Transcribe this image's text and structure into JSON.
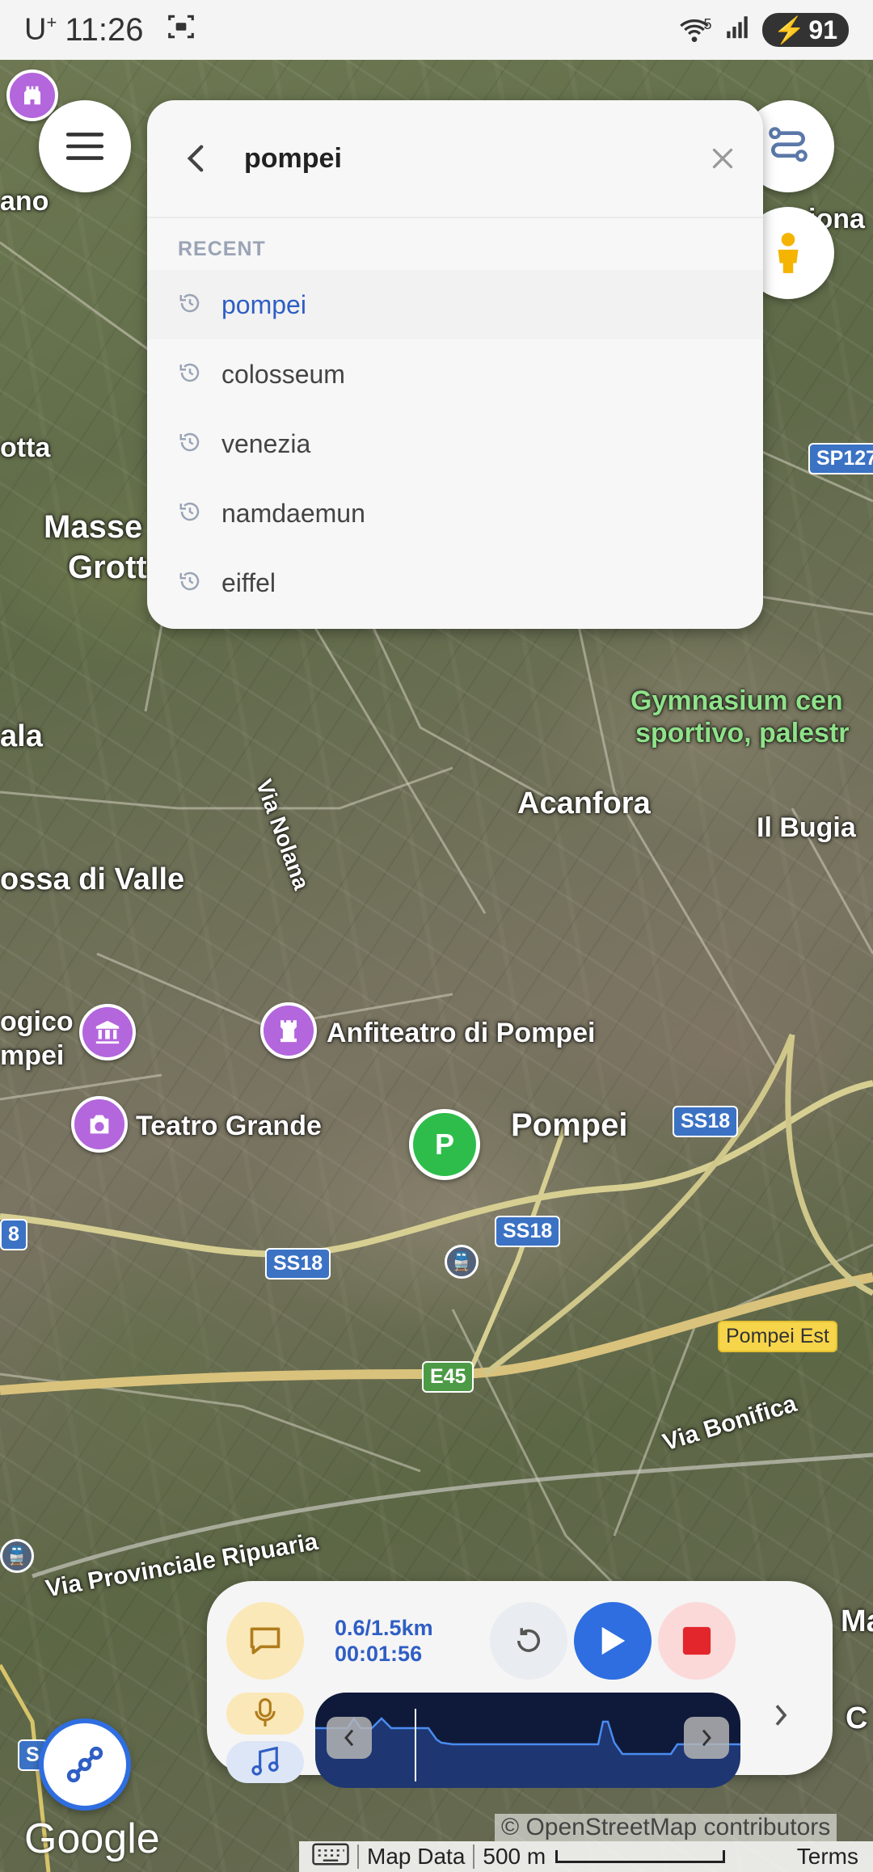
{
  "status_bar": {
    "carrier": "U",
    "carrier_sup": "+",
    "time": "11:26",
    "wifi_label": "5",
    "battery": "91"
  },
  "search": {
    "query": "pompei",
    "recent_heading": "RECENT",
    "recent_items": [
      {
        "label": "pompei",
        "active": true
      },
      {
        "label": "colosseum",
        "active": false
      },
      {
        "label": "venezia",
        "active": false
      },
      {
        "label": "namdaemun",
        "active": false
      },
      {
        "label": "eiffel",
        "active": false
      }
    ]
  },
  "map": {
    "labels": {
      "masse": "Masse",
      "grott": "Grott",
      "otta": "otta",
      "ala": "ala",
      "ossa_di_valle": "ossa di Valle",
      "via_nolana": "Via Nolana",
      "acanfora": "Acanfora",
      "il_bugia": "Il Bugia",
      "gymnasium_1": "Gymnasium cen",
      "gymnasium_2": "sportivo, palestr",
      "ano": "ano",
      "iona": "iona",
      "logico": "ogico",
      "mpei": "mpei",
      "anfiteatro": "Anfiteatro di Pompei",
      "teatro_grande": "Teatro Grande",
      "pompei": "Pompei",
      "via_bonifica": "Via Bonifica",
      "via_provinciale": "Via Provinciale Ripuaria",
      "mari": "Mari",
      "c_edge": "C"
    },
    "shields": {
      "sp127": "SP127",
      "ss18_a": "SS18",
      "ss18_b": "SS18",
      "ss18_c": "SS18",
      "e45": "E45",
      "pompei_est": "Pompei Est",
      "edge_8": "8",
      "edge_s": "S"
    },
    "pin_label": "P"
  },
  "player": {
    "distance": "0.6/1.5km",
    "elapsed": "00:01:56"
  },
  "attribution": {
    "google": "Google",
    "osm": "© OpenStreetMap contributors",
    "map_data": "Map Data",
    "scale": "500 m",
    "terms": "Terms"
  },
  "colors": {
    "accent_blue": "#2f5ec4",
    "play_blue": "#2f6ee0",
    "stop_red": "#e3262c",
    "poi_purple": "#b466dd",
    "pin_green": "#2ebd4b"
  }
}
